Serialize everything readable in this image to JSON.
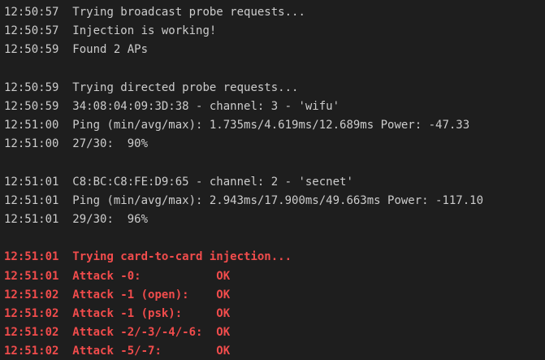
{
  "colors": {
    "background": "#1e1e1e",
    "text": "#cccccc",
    "error_red": "#f14c4c"
  },
  "lines": [
    {
      "time": "12:50:57",
      "text": "Trying broadcast probe requests...",
      "style": "normal"
    },
    {
      "time": "12:50:57",
      "text": "Injection is working!",
      "style": "normal"
    },
    {
      "time": "12:50:59",
      "text": "Found 2 APs",
      "style": "normal"
    },
    {
      "time": "",
      "text": "",
      "style": "blank"
    },
    {
      "time": "12:50:59",
      "text": "Trying directed probe requests...",
      "style": "normal"
    },
    {
      "time": "12:50:59",
      "text": "34:08:04:09:3D:38 - channel: 3 - 'wifu'",
      "style": "normal"
    },
    {
      "time": "12:51:00",
      "text": "Ping (min/avg/max): 1.735ms/4.619ms/12.689ms Power: -47.33",
      "style": "normal"
    },
    {
      "time": "12:51:00",
      "text": "27/30:  90%",
      "style": "normal"
    },
    {
      "time": "",
      "text": "",
      "style": "blank"
    },
    {
      "time": "12:51:01",
      "text": "C8:BC:C8:FE:D9:65 - channel: 2 - 'secnet'",
      "style": "normal"
    },
    {
      "time": "12:51:01",
      "text": "Ping (min/avg/max): 2.943ms/17.900ms/49.663ms Power: -117.10",
      "style": "normal"
    },
    {
      "time": "12:51:01",
      "text": "29/30:  96%",
      "style": "normal"
    },
    {
      "time": "",
      "text": "",
      "style": "blank"
    },
    {
      "time": "12:51:01",
      "text": "Trying card-to-card injection...",
      "style": "red"
    },
    {
      "time": "12:51:01",
      "text": "Attack -0:           OK",
      "style": "red"
    },
    {
      "time": "12:51:02",
      "text": "Attack -1 (open):    OK",
      "style": "red"
    },
    {
      "time": "12:51:02",
      "text": "Attack -1 (psk):     OK",
      "style": "red"
    },
    {
      "time": "12:51:02",
      "text": "Attack -2/-3/-4/-6:  OK",
      "style": "red"
    },
    {
      "time": "12:51:02",
      "text": "Attack -5/-7:        OK",
      "style": "red"
    }
  ]
}
